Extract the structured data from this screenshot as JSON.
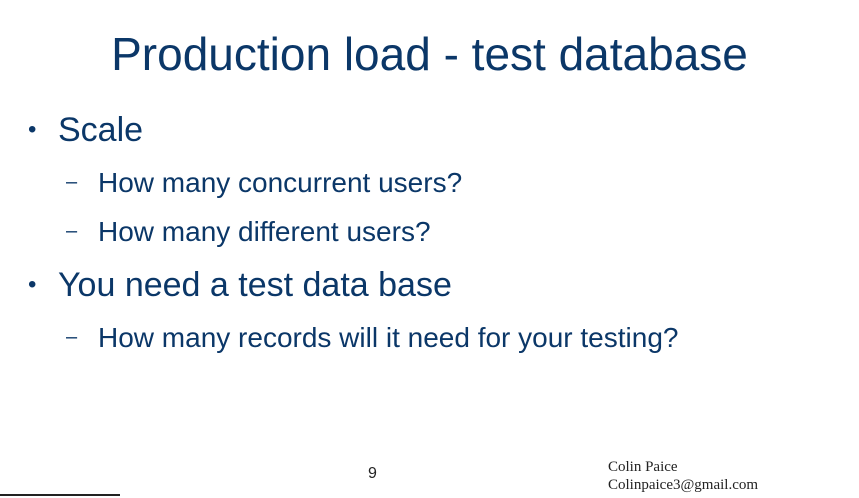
{
  "slide": {
    "title": "Production load - test database",
    "bullets": [
      {
        "text": "Scale",
        "subitems": [
          "How many concurrent users?",
          "How many different users?"
        ]
      },
      {
        "text": "You need a test data base",
        "subitems": [
          "How many records will it need for your testing?"
        ]
      }
    ],
    "bullet_glyph": "•",
    "subitem_glyph": "–",
    "page_number": "9",
    "footer": {
      "author_name": "Colin Paice",
      "author_email": "Colinpaice3@gmail.com"
    }
  },
  "colors": {
    "title": "#0b3768",
    "text": "#0b3768",
    "background": "#ffffff"
  }
}
